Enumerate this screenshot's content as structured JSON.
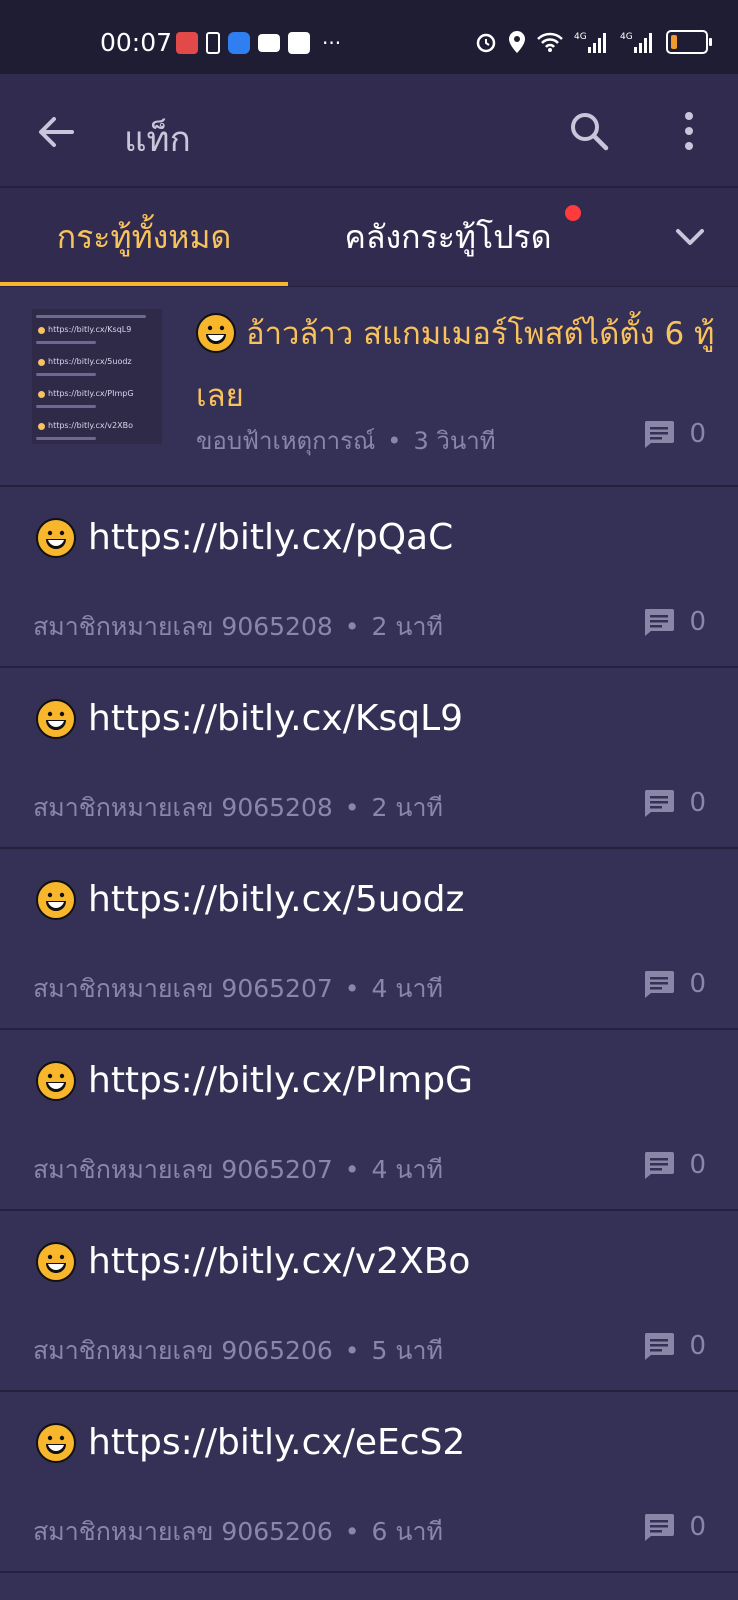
{
  "status_bar": {
    "time": "00:07",
    "icons": [
      "app-notification-icon",
      "battery-saver-icon",
      "shield-icon",
      "mail-icon",
      "contact-card-icon"
    ],
    "more": "···",
    "right_icons": [
      "alarm-icon",
      "location-icon",
      "wifi-icon",
      "signal-4g-icon",
      "signal-4g-icon",
      "battery-icon"
    ],
    "battery_level": 0.18
  },
  "app_bar": {
    "title": "แท็ก"
  },
  "tabs": [
    {
      "label": "กระทู้ทั้งหมด",
      "active": true
    },
    {
      "label": "คลังกระทู้โปรด",
      "active": false,
      "has_dot": true
    }
  ],
  "posts": [
    {
      "title": "อ้าวล้าว สแกมเมอร์โพสต์ได้ตั้ง 6 ทู้เลย",
      "author": "ขอบฟ้าเหตุการณ์",
      "time": "3 วินาที",
      "comments": "0",
      "thumbnail": {
        "lines": [
          "https://bitly.cx/KsqL9",
          "https://bitly.cx/5uodz",
          "https://bitly.cx/PImpG",
          "https://bitly.cx/v2XBo"
        ]
      }
    },
    {
      "title": "https://bitly.cx/pQaC",
      "author": "สมาชิกหมายเลข 9065208",
      "time": "2 นาที",
      "comments": "0"
    },
    {
      "title": "https://bitly.cx/KsqL9",
      "author": "สมาชิกหมายเลข 9065208",
      "time": "2 นาที",
      "comments": "0"
    },
    {
      "title": "https://bitly.cx/5uodz",
      "author": "สมาชิกหมายเลข 9065207",
      "time": "4 นาที",
      "comments": "0"
    },
    {
      "title": "https://bitly.cx/PImpG",
      "author": "สมาชิกหมายเลข 9065207",
      "time": "4 นาที",
      "comments": "0"
    },
    {
      "title": "https://bitly.cx/v2XBo",
      "author": "สมาชิกหมายเลข 9065206",
      "time": "5 นาที",
      "comments": "0"
    },
    {
      "title": "https://bitly.cx/eEcS2",
      "author": "สมาชิกหมายเลข 9065206",
      "time": "6 นาที",
      "comments": "0"
    }
  ],
  "meta_separator": "•",
  "colors": {
    "background": "#353055",
    "app_bar": "#312c4f",
    "accent": "#f8c25c",
    "muted": "#8a86a8",
    "dot": "#ff3b3b"
  }
}
